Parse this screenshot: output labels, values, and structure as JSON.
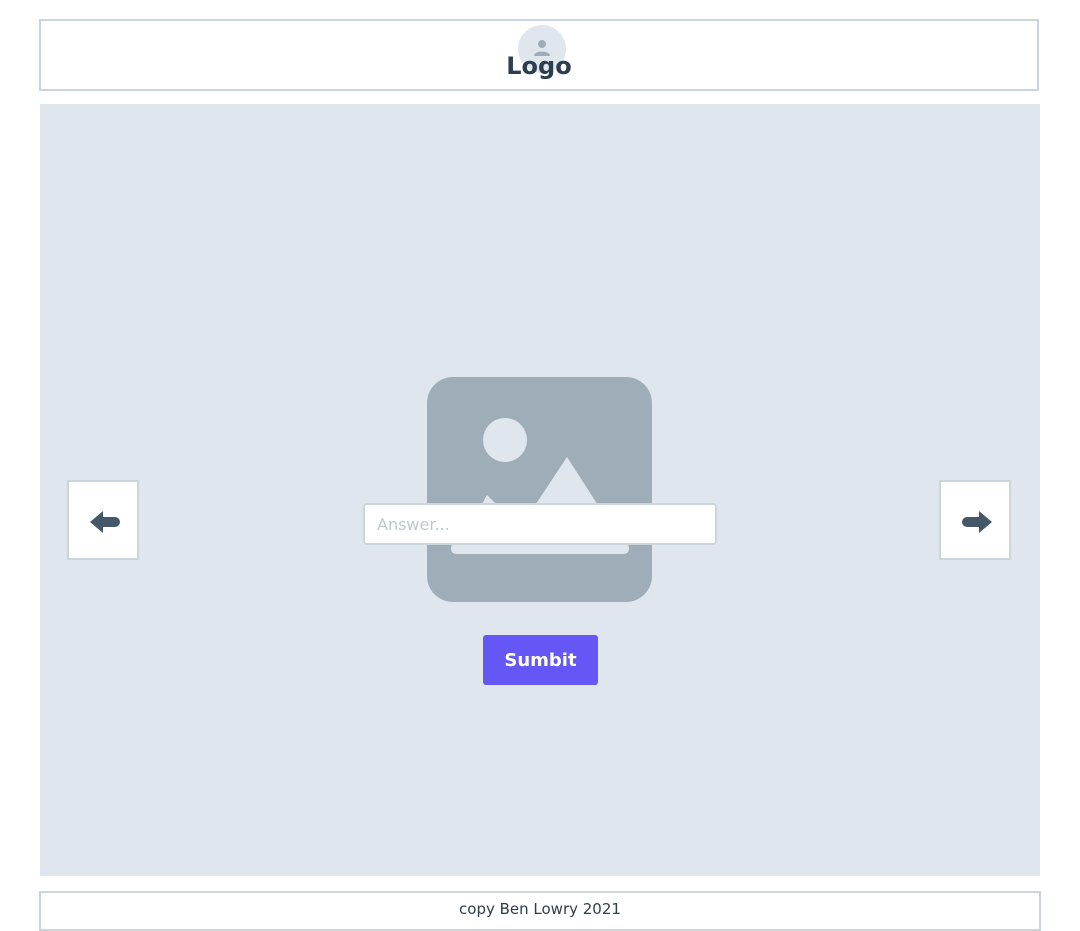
{
  "header": {
    "logo_text": "Logo",
    "avatar_icon": "user-icon"
  },
  "carousel": {
    "prev_icon": "arrow-left-icon",
    "next_icon": "arrow-right-icon",
    "image_icon": "image-placeholder-icon"
  },
  "form": {
    "answer_placeholder": "Answer...",
    "answer_value": "",
    "submit_label": "Sumbit"
  },
  "footer": {
    "copyright": "copy Ben Lowry 2021"
  },
  "colors": {
    "accent": "#6557f5",
    "panel_bg": "#dfe6ee",
    "border": "#cbd5dc",
    "icon_fill": "#9fadb9",
    "text_dark": "#2d3e4e"
  }
}
